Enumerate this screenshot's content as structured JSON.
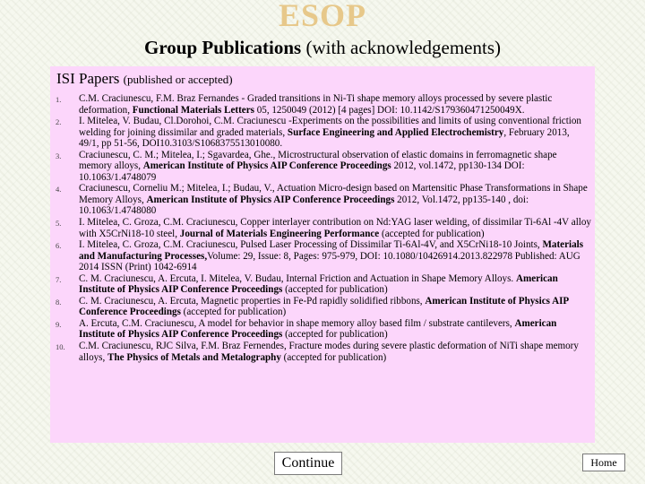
{
  "logo_text": "ESOP",
  "heading": {
    "bold": "Group Publications",
    "rest": " (with acknowledgements)"
  },
  "panel": {
    "title": "ISI Papers",
    "subtitle": "(published or accepted)"
  },
  "publications": [
    {
      "number": "1.",
      "parts": [
        {
          "text": "C.M. Craciunescu, F.M. Braz Fernandes - Graded transitions in Ni-Ti shape memory alloys processed by severe plastic deformation, ",
          "bold": false
        },
        {
          "text": "Functional Materials Letters",
          "bold": true
        },
        {
          "text": " 05, 1250049 (2012) [4 pages] DOI: 10.1142/S179360471250049X.",
          "bold": false
        }
      ]
    },
    {
      "number": "2.",
      "parts": [
        {
          "text": "I. Mitelea, V. Budau, Cl.Dorohoi, C.M. Craciunescu -Experiments on the possibilities and limits of using conventional friction welding for joining dissimilar and graded materials, ",
          "bold": false
        },
        {
          "text": "Surface Engineering and Applied Electrochemistry",
          "bold": true
        },
        {
          "text": ", February 2013, 49/1, pp 51-56, DOI10.3103/S1068375513010080.",
          "bold": false
        }
      ]
    },
    {
      "number": "3.",
      "parts": [
        {
          "text": "Craciunescu, C. M.; Mitelea, I.; Sgavardea, Ghe., Microstructural observation of elastic domains in ferromagnetic shape memory alloys, ",
          "bold": false
        },
        {
          "text": "American Institute of Physics AIP Conference Proceedings",
          "bold": true
        },
        {
          "text": " 2012, vol.1472, pp130-134 DOI: 10.1063/1.4748079",
          "bold": false
        }
      ]
    },
    {
      "number": "4.",
      "parts": [
        {
          "text": "Craciunescu, Corneliu M.; Mitelea, I.; Budau, V., Actuation Micro-design based on Martensitic Phase Transformations in Shape Memory Alloys, ",
          "bold": false
        },
        {
          "text": "American Institute of Physics AIP Conference Proceedings",
          "bold": true
        },
        {
          "text": " 2012, Vol.1472, pp135-140 , doi: 10.1063/1.4748080",
          "bold": false
        }
      ]
    },
    {
      "number": "5.",
      "parts": [
        {
          "text": "I. Mitelea, C. Groza, C.M. Craciunescu, Copper interlayer contribution on Nd:YAG laser welding, of dissimilar Ti-6Al -4V alloy with X5CrNi18-10 steel, ",
          "bold": false
        },
        {
          "text": "Journal of  Materials Engineering Performance",
          "bold": true
        },
        {
          "text": " (accepted for publication)",
          "bold": false
        }
      ]
    },
    {
      "number": "6.",
      "parts": [
        {
          "text": "I. Mitelea, C. Groza, C.M. Craciunescu, Pulsed Laser Processing of Dissimilar Ti-6Al-4V, and X5CrNi18-10 Joints, ",
          "bold": false
        },
        {
          "text": "Materials and Manufacturing Processes,",
          "bold": true
        },
        {
          "text": "Volume: 29, Issue: 8, Pages: 975-979, DOI: 10.1080/10426914.2013.822978 Published: AUG 2014 ISSN (Print) 1042-6914",
          "bold": false
        }
      ]
    },
    {
      "number": "7.",
      "parts": [
        {
          "text": "C. M. Craciunescu, A. Ercuta, I. Mitelea, V. Budau, Internal Friction and Actuation in Shape Memory Alloys. ",
          "bold": false
        },
        {
          "text": "American Institute of Physics AIP Conference Proceedings",
          "bold": true
        },
        {
          "text": " (accepted for publication)",
          "bold": false
        }
      ]
    },
    {
      "number": "8.",
      "parts": [
        {
          "text": "C. M. Craciunescu, A. Ercuta, Magnetic properties in Fe-Pd rapidly solidified ribbons, ",
          "bold": false
        },
        {
          "text": "American Institute of Physics AIP Conference Proceedings",
          "bold": true
        },
        {
          "text": " (accepted for publication)",
          "bold": false
        }
      ]
    },
    {
      "number": "9.",
      "parts": [
        {
          "text": "A. Ercuta, C.M. Craciunescu, A model for behavior in shape memory alloy based film / substrate cantilevers, ",
          "bold": false
        },
        {
          "text": "American Institute of Physics AIP Conference Proceedings",
          "bold": true
        },
        {
          "text": " (accepted for publication)",
          "bold": false
        }
      ]
    },
    {
      "number": "10.",
      "parts": [
        {
          "text": "C.M. Craciunescu, RJC Silva, F.M. Braz Fernendes, Fracture modes during severe plastic deformation of NiTi shape memory alloys, ",
          "bold": false
        },
        {
          "text": "The Physics of Metals and Metalography",
          "bold": true
        },
        {
          "text": " (accepted for publication)",
          "bold": false
        }
      ]
    }
  ],
  "buttons": {
    "continue": "Continue",
    "home": "Home"
  },
  "colors": {
    "logo": "#e7c88a",
    "panel_background": "#fcd6fb",
    "page_background": "#f6f8ef"
  }
}
